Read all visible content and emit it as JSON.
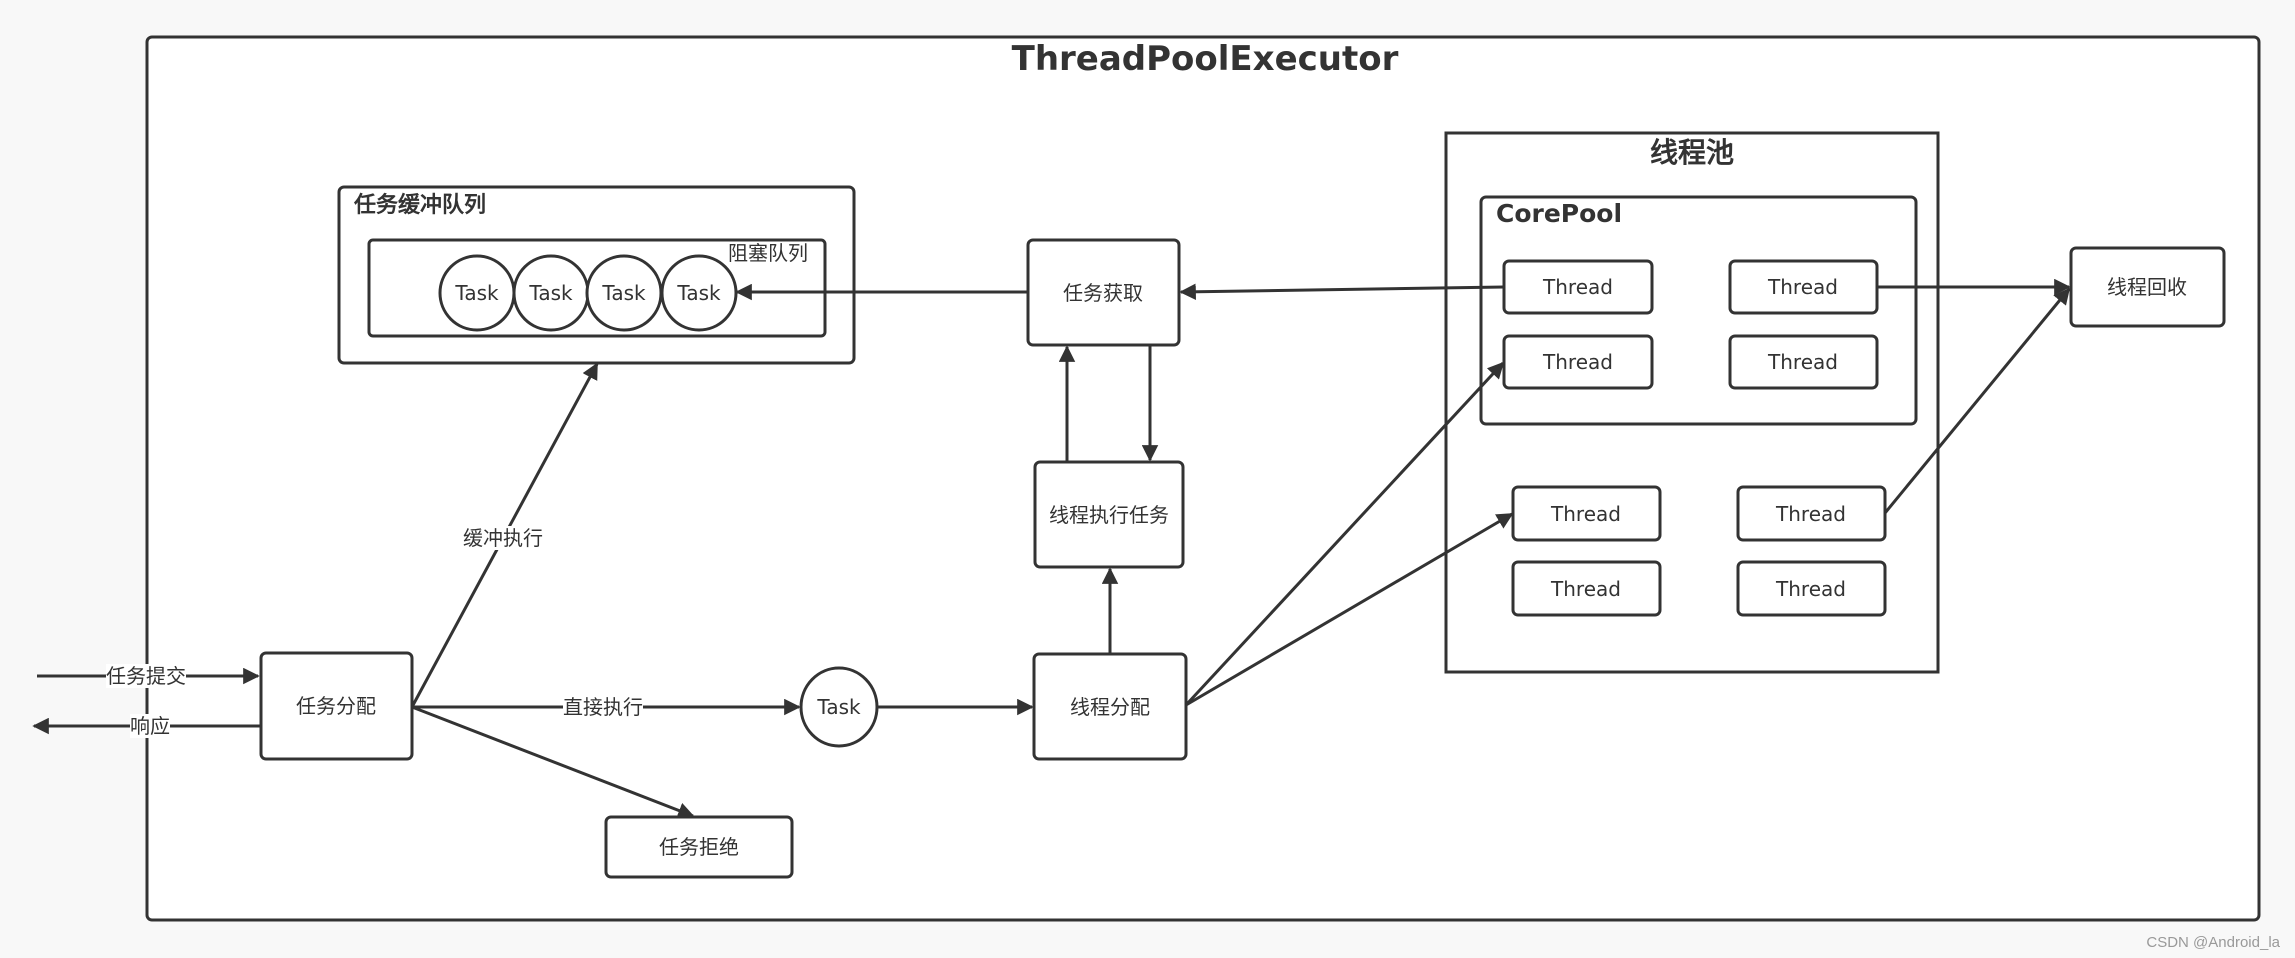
{
  "diagram": {
    "title": "ThreadPoolExecutor",
    "watermark": "CSDN @Android_la",
    "external": {
      "submit_label": "任务提交",
      "response_label": "响应"
    },
    "nodes": {
      "task_dispatch": "任务分配",
      "task_reject": "任务拒绝",
      "direct_task": "Task",
      "thread_dispatch": "线程分配",
      "thread_exec": "线程执行任务",
      "task_fetch": "任务获取",
      "thread_recycle": "线程回收"
    },
    "buffer_queue": {
      "title": "任务缓冲队列",
      "blocking_queue_label": "阻塞队列",
      "tasks": [
        "Task",
        "Task",
        "Task",
        "Task"
      ]
    },
    "thread_pool": {
      "title": "线程池",
      "core_pool": {
        "title": "CorePool",
        "threads": [
          "Thread",
          "Thread",
          "Thread",
          "Thread"
        ]
      },
      "non_core_threads": [
        "Thread",
        "Thread",
        "Thread",
        "Thread"
      ]
    },
    "edge_labels": {
      "buffer_exec": "缓冲执行",
      "direct_exec": "直接执行"
    },
    "colors": {
      "stroke": "#333333",
      "background": "#f8f8f8",
      "canvas": "#ffffff",
      "watermark": "#999999"
    }
  }
}
